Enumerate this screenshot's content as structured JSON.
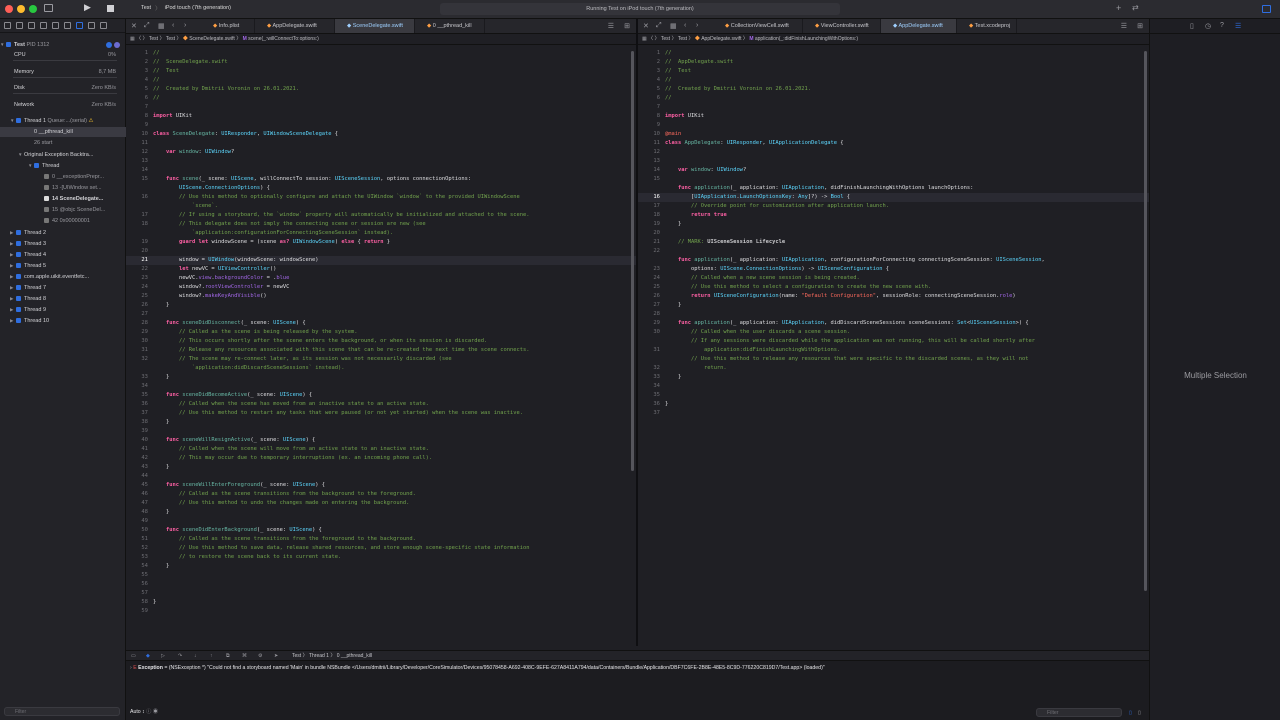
{
  "toolbar": {
    "scheme": "Test",
    "destination": "iPod touch (7th generation)",
    "activity": "Running Test on iPod touch (7th generation)"
  },
  "navigator": {
    "process": "Test",
    "pid": "PID 1312",
    "gauges": [
      {
        "label": "CPU",
        "value": "0%"
      },
      {
        "label": "Memory",
        "value": "8,7 MB"
      },
      {
        "label": "Disk",
        "value": "Zero KB/s"
      },
      {
        "label": "Network",
        "value": "Zero KB/s"
      }
    ],
    "thread1": "Thread 1",
    "thread1_queue": "Queue:...(serial)",
    "frames1": [
      "0 __pthread_kill",
      "26 start"
    ],
    "backtrace": "Original Exception Backtra...",
    "thread_sub": "Thread",
    "frames2": [
      "0 __exceptionPrepr...",
      "13 -[UIWindow set...",
      "14 SceneDelegate...",
      "15 @objc SceneDel...",
      "42 0x00000001"
    ],
    "threads": [
      "Thread 2",
      "Thread 3",
      "Thread 4",
      "Thread 5",
      "com.apple.uikit.eventfetc...",
      "Thread 7",
      "Thread 8",
      "Thread 9",
      "Thread 10"
    ],
    "filter_placeholder": "Filter"
  },
  "left_tabs": [
    "Info.plist",
    "AppDelegate.swift",
    "SceneDelegate.swift",
    "0 __pthread_kill"
  ],
  "left_active_tab": 2,
  "right_tabs": [
    "CollectionViewCell.swift",
    "ViewController.swift",
    "AppDelegate.swift",
    "Test.xcodeproj"
  ],
  "right_active_tab": 2,
  "left_jump": [
    "Test",
    "Test",
    "SceneDelegate.swift",
    "scene(_:willConnectTo:options:)"
  ],
  "right_jump": [
    "Test",
    "Test",
    "AppDelegate.swift",
    "application(_:didFinishLaunchingWithOptions:)"
  ],
  "left_current_line": 21,
  "right_current_line": 16,
  "left_code": [
    [
      [
        "c",
        "//"
      ]
    ],
    [
      [
        "c",
        "//  SceneDelegate.swift"
      ]
    ],
    [
      [
        "c",
        "//  Test"
      ]
    ],
    [
      [
        "c",
        "//"
      ]
    ],
    [
      [
        "c",
        "//  Created by Dmitrii Voronin on 26.01.2021."
      ]
    ],
    [
      [
        "c",
        "//"
      ]
    ],
    [],
    [
      [
        "k",
        "import"
      ],
      [
        "t",
        " UIKit"
      ]
    ],
    [],
    [
      [
        "k",
        "class"
      ],
      [
        "t",
        " "
      ],
      [
        "f",
        "SceneDelegate"
      ],
      [
        "t",
        ": "
      ],
      [
        "y",
        "UIResponder"
      ],
      [
        "t",
        ", "
      ],
      [
        "y",
        "UIWindowSceneDelegate"
      ],
      [
        "t",
        " {"
      ]
    ],
    [],
    [
      [
        "t",
        "    "
      ],
      [
        "k",
        "var"
      ],
      [
        "t",
        " "
      ],
      [
        "f",
        "window"
      ],
      [
        "t",
        ": "
      ],
      [
        "y",
        "UIWindow"
      ],
      [
        "t",
        "?"
      ]
    ],
    [],
    [],
    [
      [
        "t",
        "    "
      ],
      [
        "k",
        "func"
      ],
      [
        "t",
        " "
      ],
      [
        "f",
        "scene"
      ],
      [
        "t",
        "(_ scene: "
      ],
      [
        "y",
        "UIScene"
      ],
      [
        "t",
        ", willConnectTo session: "
      ],
      [
        "y",
        "UISceneSession"
      ],
      [
        "t",
        ", options connectionOptions:"
      ]
    ],
    [
      [
        "t",
        "        "
      ],
      [
        "y",
        "UIScene"
      ],
      [
        "t",
        "."
      ],
      [
        "y",
        "ConnectionOptions"
      ],
      [
        "t",
        ") {"
      ]
    ],
    [
      [
        "t",
        "        "
      ],
      [
        "c",
        "// Use this method to optionally configure and attach the UIWindow `window` to the provided UIWindowScene"
      ]
    ],
    [
      [
        "t",
        "            "
      ],
      [
        "c",
        "`scene`."
      ]
    ],
    [
      [
        "t",
        "        "
      ],
      [
        "c",
        "// If using a storyboard, the `window` property will automatically be initialized and attached to the scene."
      ]
    ],
    [
      [
        "t",
        "        "
      ],
      [
        "c",
        "// This delegate does not imply the connecting scene or session are new (see"
      ]
    ],
    [
      [
        "t",
        "            "
      ],
      [
        "c",
        "`application:configurationForConnectingSceneSession` instead)."
      ]
    ],
    [
      [
        "t",
        "        "
      ],
      [
        "k",
        "guard"
      ],
      [
        "t",
        " "
      ],
      [
        "k",
        "let"
      ],
      [
        "t",
        " windowScene = (scene "
      ],
      [
        "k",
        "as?"
      ],
      [
        "t",
        " "
      ],
      [
        "y",
        "UIWindowScene"
      ],
      [
        "t",
        ") "
      ],
      [
        "k",
        "else"
      ],
      [
        "t",
        " { "
      ],
      [
        "k",
        "return"
      ],
      [
        "t",
        " }"
      ]
    ],
    [],
    [
      [
        "t",
        "        window = "
      ],
      [
        "y",
        "UIWindow"
      ],
      [
        "t",
        "(windowScene: windowScene)"
      ]
    ],
    [
      [
        "t",
        "        "
      ],
      [
        "k",
        "let"
      ],
      [
        "t",
        " newVC = "
      ],
      [
        "y",
        "UIViewController"
      ],
      [
        "t",
        "()"
      ]
    ],
    [
      [
        "t",
        "        newVC."
      ],
      [
        "p",
        "view"
      ],
      [
        "t",
        "."
      ],
      [
        "p",
        "backgroundColor"
      ],
      [
        "t",
        " = ."
      ],
      [
        "p",
        "blue"
      ]
    ],
    [
      [
        "t",
        "        window?."
      ],
      [
        "p",
        "rootViewController"
      ],
      [
        "t",
        " = newVC"
      ]
    ],
    [
      [
        "t",
        "        window?."
      ],
      [
        "p",
        "makeKeyAndVisible"
      ],
      [
        "t",
        "()"
      ]
    ],
    [
      [
        "t",
        "    }"
      ]
    ],
    [],
    [
      [
        "t",
        "    "
      ],
      [
        "k",
        "func"
      ],
      [
        "t",
        " "
      ],
      [
        "f",
        "sceneDidDisconnect"
      ],
      [
        "t",
        "(_ scene: "
      ],
      [
        "y",
        "UIScene"
      ],
      [
        "t",
        ") {"
      ]
    ],
    [
      [
        "t",
        "        "
      ],
      [
        "c",
        "// Called as the scene is being released by the system."
      ]
    ],
    [
      [
        "t",
        "        "
      ],
      [
        "c",
        "// This occurs shortly after the scene enters the background, or when its session is discarded."
      ]
    ],
    [
      [
        "t",
        "        "
      ],
      [
        "c",
        "// Release any resources associated with this scene that can be re-created the next time the scene connects."
      ]
    ],
    [
      [
        "t",
        "        "
      ],
      [
        "c",
        "// The scene may re-connect later, as its session was not necessarily discarded (see"
      ]
    ],
    [
      [
        "t",
        "            "
      ],
      [
        "c",
        "`application:didDiscardSceneSessions` instead)."
      ]
    ],
    [
      [
        "t",
        "    }"
      ]
    ],
    [],
    [
      [
        "t",
        "    "
      ],
      [
        "k",
        "func"
      ],
      [
        "t",
        " "
      ],
      [
        "f",
        "sceneDidBecomeActive"
      ],
      [
        "t",
        "(_ scene: "
      ],
      [
        "y",
        "UIScene"
      ],
      [
        "t",
        ") {"
      ]
    ],
    [
      [
        "t",
        "        "
      ],
      [
        "c",
        "// Called when the scene has moved from an inactive state to an active state."
      ]
    ],
    [
      [
        "t",
        "        "
      ],
      [
        "c",
        "// Use this method to restart any tasks that were paused (or not yet started) when the scene was inactive."
      ]
    ],
    [
      [
        "t",
        "    }"
      ]
    ],
    [],
    [
      [
        "t",
        "    "
      ],
      [
        "k",
        "func"
      ],
      [
        "t",
        " "
      ],
      [
        "f",
        "sceneWillResignActive"
      ],
      [
        "t",
        "(_ scene: "
      ],
      [
        "y",
        "UIScene"
      ],
      [
        "t",
        ") {"
      ]
    ],
    [
      [
        "t",
        "        "
      ],
      [
        "c",
        "// Called when the scene will move from an active state to an inactive state."
      ]
    ],
    [
      [
        "t",
        "        "
      ],
      [
        "c",
        "// This may occur due to temporary interruptions (ex. an incoming phone call)."
      ]
    ],
    [
      [
        "t",
        "    }"
      ]
    ],
    [],
    [
      [
        "t",
        "    "
      ],
      [
        "k",
        "func"
      ],
      [
        "t",
        " "
      ],
      [
        "f",
        "sceneWillEnterForeground"
      ],
      [
        "t",
        "(_ scene: "
      ],
      [
        "y",
        "UIScene"
      ],
      [
        "t",
        ") {"
      ]
    ],
    [
      [
        "t",
        "        "
      ],
      [
        "c",
        "// Called as the scene transitions from the background to the foreground."
      ]
    ],
    [
      [
        "t",
        "        "
      ],
      [
        "c",
        "// Use this method to undo the changes made on entering the background."
      ]
    ],
    [
      [
        "t",
        "    }"
      ]
    ],
    [],
    [
      [
        "t",
        "    "
      ],
      [
        "k",
        "func"
      ],
      [
        "t",
        " "
      ],
      [
        "f",
        "sceneDidEnterBackground"
      ],
      [
        "t",
        "(_ scene: "
      ],
      [
        "y",
        "UIScene"
      ],
      [
        "t",
        ") {"
      ]
    ],
    [
      [
        "t",
        "        "
      ],
      [
        "c",
        "// Called as the scene transitions from the foreground to the background."
      ]
    ],
    [
      [
        "t",
        "        "
      ],
      [
        "c",
        "// Use this method to save data, release shared resources, and store enough scene-specific state information"
      ]
    ],
    [
      [
        "t",
        "        "
      ],
      [
        "c",
        "// to restore the scene back to its current state."
      ]
    ],
    [
      [
        "t",
        "    }"
      ]
    ],
    [],
    [],
    [],
    [
      [
        "t",
        "}"
      ]
    ],
    [],
    []
  ],
  "right_code": [
    [
      [
        "c",
        "//"
      ]
    ],
    [
      [
        "c",
        "//  AppDelegate.swift"
      ]
    ],
    [
      [
        "c",
        "//  Test"
      ]
    ],
    [
      [
        "c",
        "//"
      ]
    ],
    [
      [
        "c",
        "//  Created by Dmitrii Voronin on 26.01.2021."
      ]
    ],
    [
      [
        "c",
        "//"
      ]
    ],
    [],
    [
      [
        "k",
        "import"
      ],
      [
        "t",
        " UIKit"
      ]
    ],
    [],
    [
      [
        "s",
        "@main"
      ]
    ],
    [
      [
        "k",
        "class"
      ],
      [
        "t",
        " "
      ],
      [
        "f",
        "AppDelegate"
      ],
      [
        "t",
        ": "
      ],
      [
        "y",
        "UIResponder"
      ],
      [
        "t",
        ", "
      ],
      [
        "y",
        "UIApplicationDelegate"
      ],
      [
        "t",
        " {"
      ]
    ],
    [],
    [],
    [
      [
        "t",
        "    "
      ],
      [
        "k",
        "var"
      ],
      [
        "t",
        " "
      ],
      [
        "f",
        "window"
      ],
      [
        "t",
        ": "
      ],
      [
        "y",
        "UIWindow"
      ],
      [
        "t",
        "?"
      ]
    ],
    [],
    [
      [
        "t",
        "    "
      ],
      [
        "k",
        "func"
      ],
      [
        "t",
        " "
      ],
      [
        "f",
        "application"
      ],
      [
        "t",
        "(_ application: "
      ],
      [
        "y",
        "UIApplication"
      ],
      [
        "t",
        ", didFinishLaunchingWithOptions launchOptions:"
      ]
    ],
    [
      [
        "t",
        "        ["
      ],
      [
        "y",
        "UIApplication"
      ],
      [
        "t",
        "."
      ],
      [
        "y",
        "LaunchOptionsKey"
      ],
      [
        "t",
        ": "
      ],
      [
        "y",
        "Any"
      ],
      [
        "t",
        "]?) -> "
      ],
      [
        "y",
        "Bool"
      ],
      [
        "t",
        " {"
      ]
    ],
    [
      [
        "t",
        "        "
      ],
      [
        "c",
        "// Override point for customization after application launch."
      ]
    ],
    [
      [
        "t",
        "        "
      ],
      [
        "k",
        "return"
      ],
      [
        "t",
        " "
      ],
      [
        "k",
        "true"
      ]
    ],
    [
      [
        "t",
        "    }"
      ]
    ],
    [],
    [
      [
        "t",
        "    "
      ],
      [
        "c",
        "// MARK: "
      ],
      [
        "m",
        "UISceneSession Lifecycle"
      ]
    ],
    [],
    [
      [
        "t",
        "    "
      ],
      [
        "k",
        "func"
      ],
      [
        "t",
        " "
      ],
      [
        "f",
        "application"
      ],
      [
        "t",
        "(_ application: "
      ],
      [
        "y",
        "UIApplication"
      ],
      [
        "t",
        ", configurationForConnecting connectingSceneSession: "
      ],
      [
        "y",
        "UISceneSession"
      ],
      [
        "t",
        ","
      ]
    ],
    [
      [
        "t",
        "        options: "
      ],
      [
        "y",
        "UIScene"
      ],
      [
        "t",
        "."
      ],
      [
        "y",
        "ConnectionOptions"
      ],
      [
        "t",
        ") -> "
      ],
      [
        "y",
        "UISceneConfiguration"
      ],
      [
        "t",
        " {"
      ]
    ],
    [
      [
        "t",
        "        "
      ],
      [
        "c",
        "// Called when a new scene session is being created."
      ]
    ],
    [
      [
        "t",
        "        "
      ],
      [
        "c",
        "// Use this method to select a configuration to create the new scene with."
      ]
    ],
    [
      [
        "t",
        "        "
      ],
      [
        "k",
        "return"
      ],
      [
        "t",
        " "
      ],
      [
        "y",
        "UISceneConfiguration"
      ],
      [
        "t",
        "(name: "
      ],
      [
        "s",
        "\"Default Configuration\""
      ],
      [
        "t",
        ", sessionRole: connectingSceneSession."
      ],
      [
        "p",
        "role"
      ],
      [
        "t",
        ")"
      ]
    ],
    [
      [
        "t",
        "    }"
      ]
    ],
    [],
    [
      [
        "t",
        "    "
      ],
      [
        "k",
        "func"
      ],
      [
        "t",
        " "
      ],
      [
        "f",
        "application"
      ],
      [
        "t",
        "(_ application: "
      ],
      [
        "y",
        "UIApplication"
      ],
      [
        "t",
        ", didDiscardSceneSessions sceneSessions: "
      ],
      [
        "y",
        "Set"
      ],
      [
        "t",
        "<"
      ],
      [
        "y",
        "UISceneSession"
      ],
      [
        "t",
        ">) {"
      ]
    ],
    [
      [
        "t",
        "        "
      ],
      [
        "c",
        "// Called when the user discards a scene session."
      ]
    ],
    [
      [
        "t",
        "        "
      ],
      [
        "c",
        "// If any sessions were discarded while the application was not running, this will be called shortly after"
      ]
    ],
    [
      [
        "t",
        "            "
      ],
      [
        "c",
        "application:didFinishLaunchingWithOptions."
      ]
    ],
    [
      [
        "t",
        "        "
      ],
      [
        "c",
        "// Use this method to release any resources that were specific to the discarded scenes, as they will not"
      ]
    ],
    [
      [
        "t",
        "            "
      ],
      [
        "c",
        "return."
      ]
    ],
    [
      [
        "t",
        "    }"
      ]
    ],
    [],
    [],
    [
      [
        "t",
        "}"
      ]
    ],
    [],
    []
  ],
  "left_numbers": [
    "1",
    "2",
    "3",
    "4",
    "5",
    "6",
    "7",
    "8",
    "9",
    "10",
    "11",
    "12",
    "13",
    "14",
    "15",
    "",
    "16",
    "",
    "17",
    "18",
    "",
    "19",
    "20",
    "21",
    "22",
    "23",
    "24",
    "25",
    "26",
    "27",
    "28",
    "29",
    "30",
    "31",
    "32",
    "",
    "33",
    "34",
    "35",
    "36",
    "37",
    "38",
    "39",
    "40",
    "41",
    "42",
    "43",
    "44",
    "45",
    "46",
    "47",
    "48",
    "49",
    "50",
    "51",
    "52",
    "53",
    "54",
    "55",
    "56",
    "57",
    "58",
    "59"
  ],
  "right_numbers": [
    "1",
    "2",
    "3",
    "4",
    "5",
    "6",
    "7",
    "8",
    "9",
    "10",
    "11",
    "12",
    "13",
    "14",
    "15",
    "",
    "16",
    "17",
    "18",
    "19",
    "20",
    "21",
    "22",
    "",
    "23",
    "24",
    "25",
    "26",
    "27",
    "28",
    "29",
    "30",
    "",
    "31",
    "",
    "32",
    "33",
    "34",
    "35",
    "36",
    "37"
  ],
  "debug": {
    "crumbs": [
      "Test",
      "Thread 1",
      "0 __pthread_kill"
    ],
    "exception_label": "Exception",
    "exception_text": "= (NSException *) \"Could not find a storyboard named 'Main' in bundle NSBundle </Users/dmitrii/Library/Developer/CoreSimulator/Devices/95078458-A692-408C-9EFE-627A8411A794/data/Containers/Bundle/Application/DBF7C6FE-2B8E-48E5-8C9D-776220C819D7/Test.app> (loaded)\"",
    "auto_label": "Auto ↕",
    "filter_placeholder": "Filter"
  },
  "inspector": {
    "empty_text": "Multiple Selection"
  },
  "colors": {
    "accent": "#2f6ee0",
    "keyword": "#fc5fa3",
    "type": "#5dd8ff",
    "comment": "#72a34d",
    "string": "#fc6a5d",
    "warning": "#f5c12e"
  }
}
